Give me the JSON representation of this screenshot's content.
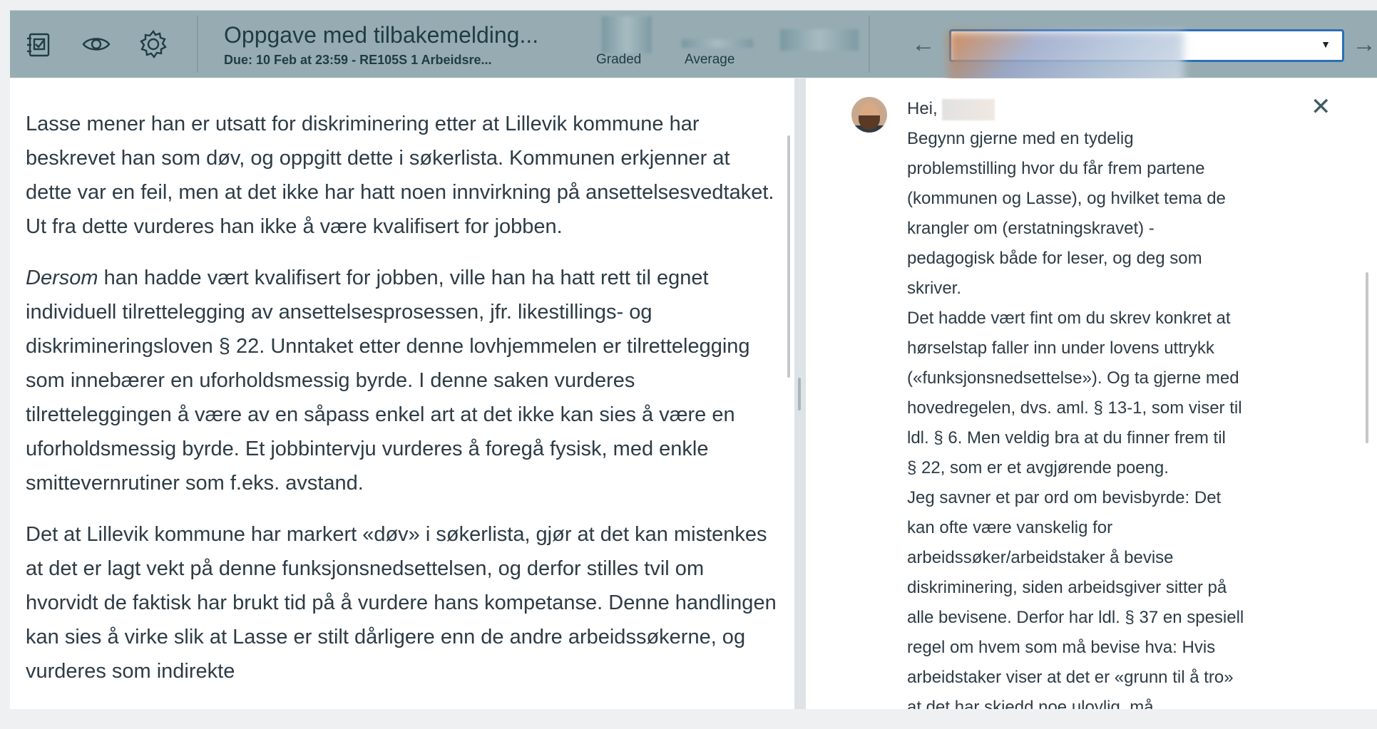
{
  "toolbar": {
    "icons": [
      "assignment-icon",
      "eye-icon",
      "gear-icon"
    ],
    "assignment_title": "Oppgave med tilbakemelding...",
    "assignment_subtitle": "Due: 10 Feb at 23:59 - RE105S 1 Arbeidsre...",
    "graded_label": "Graded",
    "average_label": "Average",
    "prev_arrow": "←",
    "next_arrow": "→",
    "select_caret": "▼"
  },
  "submission": {
    "paragraph1": "Lasse mener han er utsatt for diskriminering etter at Lillevik kommune har beskrevet han som døv, og oppgitt dette i søkerlista. Kommunen erkjenner at dette var en feil, men at det ikke har hatt noen innvirkning på ansettelsesvedtaket. Ut fra dette vurderes han ikke å være kvalifisert for jobben.",
    "paragraph2_emphasis": "Dersom",
    "paragraph2_rest": " han hadde vært kvalifisert for jobben, ville han ha hatt rett til egnet individuell tilrettelegging av ansettelsesprosessen, jfr. likestillings- og diskrimineringsloven § 22. Unntaket etter denne lovhjemmelen er tilrettelegging som innebærer en uforholdsmessig byrde. I denne saken vurderes tilretteleggingen å være av en såpass enkel art at det ikke kan sies å være en uforholdsmessig byrde. Et jobbintervju vurderes å foregå fysisk, med enkle smittevernrutiner som f.eks. avstand.",
    "paragraph3": "Det at Lillevik kommune har markert «døv» i søkerlista, gjør at det kan mistenkes at det er lagt vekt på denne funksjonsnedsettelsen, og derfor stilles tvil om hvorvidt de faktisk har brukt tid på å vurdere hans kompetanse. Denne handlingen kan sies å virke slik at Lasse er stilt dårligere enn de andre arbeidssøkerne, og vurderes som indirekte"
  },
  "comment": {
    "greeting": "Hei,",
    "lines": [
      "Begynn gjerne med en tydelig",
      "problemstilling hvor du får frem partene",
      "(kommunen og Lasse), og hvilket tema de",
      "krangler om (erstatningskravet) -",
      "pedagogisk både for leser, og deg som",
      "skriver.",
      "Det hadde vært fint om du skrev konkret at",
      "hørselstap faller inn under lovens uttrykk",
      "(«funksjonsnedsettelse»). Og ta gjerne med",
      "hovedregelen, dvs. aml. § 13-1, som viser til",
      "ldl. § 6. Men veldig bra at du finner frem til",
      "§ 22, som er et avgjørende poeng.",
      "Jeg savner et par ord om bevisbyrde: Det",
      "kan ofte være vanskelig for",
      "arbeidssøker/arbeidstaker å bevise",
      "diskriminering, siden arbeidsgiver sitter på",
      "alle bevisene. Derfor har ldl. § 37 en spesiell",
      "regel om hvem som må bevise hva: Hvis",
      "arbeidstaker viser at det er «grunn til å tro»",
      "at det har skjedd noe ulovlig, må"
    ],
    "close_symbol": "✕"
  }
}
